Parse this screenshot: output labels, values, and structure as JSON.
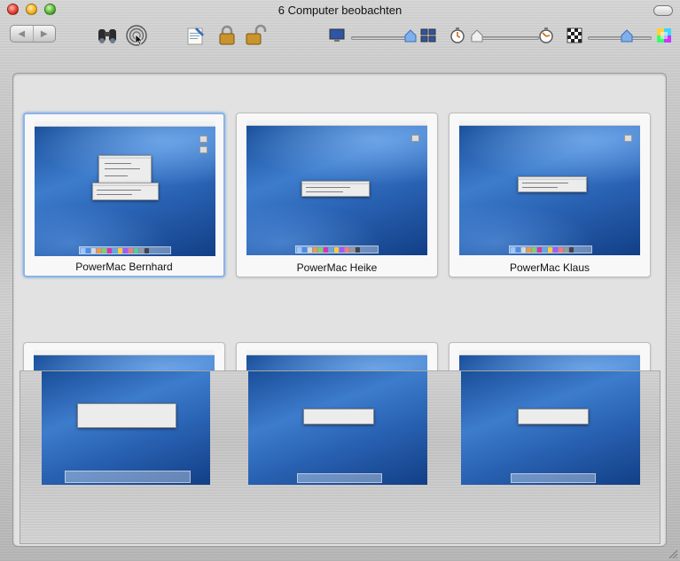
{
  "window": {
    "title": "6 Computer beobachten"
  },
  "toolbar": {
    "back_glyph": "◀",
    "forward_glyph": "▶",
    "icons": [
      "binoculars-icon",
      "observe-radar-icon",
      "notes-icon",
      "lock-icon",
      "unlock-icon",
      "screen-small-icon",
      "grid-icon",
      "clock-icon",
      "clock-alt-icon",
      "checkerboard-icon",
      "color-wheel-icon"
    ]
  },
  "computers": [
    {
      "name": "PowerMac Bernhard",
      "selected": true
    },
    {
      "name": "PowerMac Heike",
      "selected": false
    },
    {
      "name": "PowerMac Klaus",
      "selected": false
    },
    {
      "name": "",
      "selected": false
    },
    {
      "name": "",
      "selected": false
    },
    {
      "name": "",
      "selected": false
    }
  ],
  "colors": {
    "selection": "#8cb4e6",
    "desktop_blue": "#2a63b4"
  }
}
